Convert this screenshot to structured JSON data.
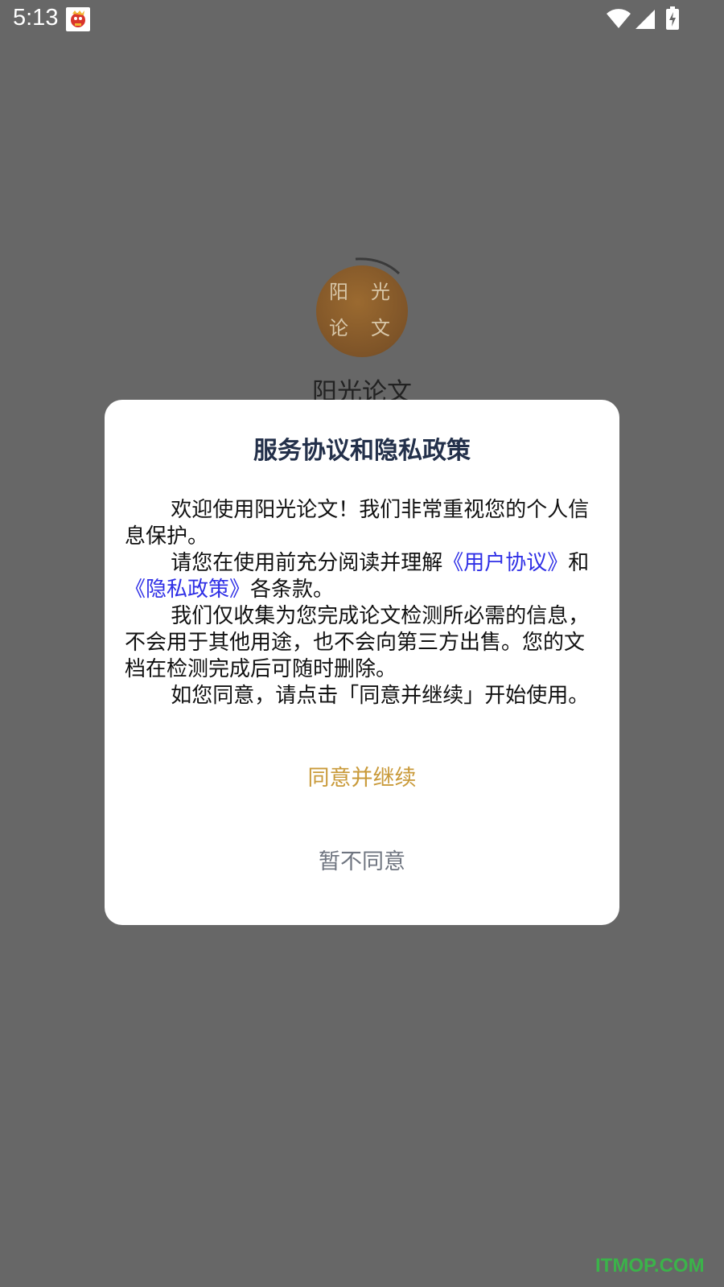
{
  "status_bar": {
    "time": "5:13",
    "icons": [
      "app-notification-icon",
      "wifi-icon",
      "signal-icon",
      "battery-charging-icon"
    ]
  },
  "splash": {
    "logo_chars": [
      "阳",
      "光",
      "论",
      "文"
    ],
    "app_name": "阳光论文",
    "logo_color": "#8a5d2c"
  },
  "dialog": {
    "title": "服务协议和隐私政策",
    "para1": "欢迎使用阳光论文！我们非常重视您的个人信息保护。",
    "para2_prefix": "请您在使用前充分阅读并理解",
    "user_agreement_link": "《用户协议》",
    "para2_and": "和",
    "privacy_policy_link": "《隐私政策》",
    "para2_suffix": "各条款。",
    "para3": "我们仅收集为您完成论文检测所必需的信息，不会用于其他用途，也不会向第三方出售。您的文档在检测完成后可随时删除。",
    "para4": "如您同意，请点击「同意并继续」开始使用。",
    "agree_label": "同意并继续",
    "decline_label": "暂不同意"
  },
  "colors": {
    "overlay": "#676767",
    "agree": "#c99a3a",
    "decline": "#6f7580",
    "link": "#2f2fe6"
  },
  "watermark": "ITMOP.COM"
}
